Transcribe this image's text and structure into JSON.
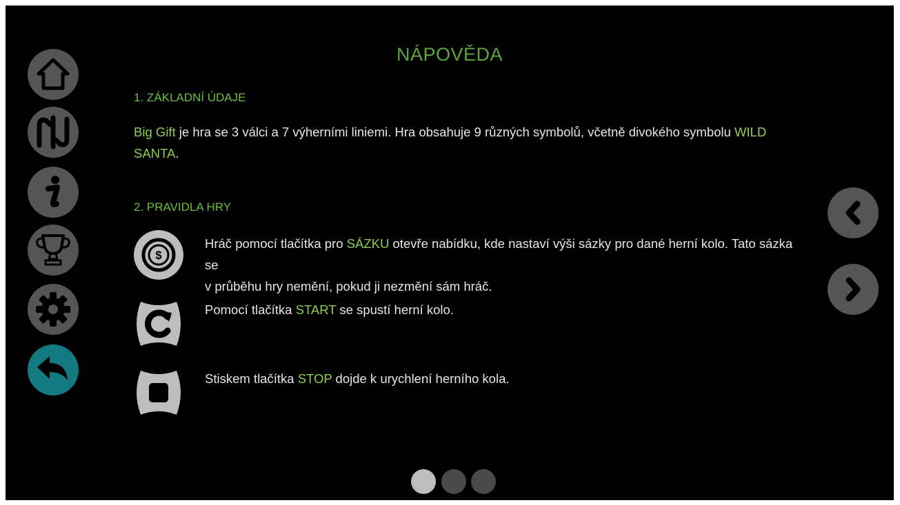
{
  "page": {
    "title": "NÁPOVĚDA"
  },
  "sidebar": {
    "items": [
      {
        "name": "home",
        "icon": "home-icon"
      },
      {
        "name": "paylines",
        "icon": "paylines-icon"
      },
      {
        "name": "info",
        "icon": "info-icon"
      },
      {
        "name": "trophy",
        "icon": "trophy-icon"
      },
      {
        "name": "settings",
        "icon": "gear-icon"
      },
      {
        "name": "back",
        "icon": "back-arrow-icon",
        "active": true
      }
    ],
    "active_color": "#147a82",
    "default_color": "#555555"
  },
  "section1": {
    "heading": "1. ZÁKLADNÍ ÚDAJE",
    "para": {
      "game_name": "Big Gift",
      "text_a": " je hra se 3 válci a 7 výherními liniemi. Hra obsahuje 9 různých symbolů, včetně divokého symbolu ",
      "wild_a": "WILD",
      "wild_b": "SANTA",
      "text_end": "."
    }
  },
  "section2": {
    "heading": "2. PRAVIDLA HRY",
    "rules": [
      {
        "icon": "bet-coin-icon",
        "pre": "Hráč pomocí tlačítka pro ",
        "key": "SÁZKU",
        "post_line1": " otevře nabídku, kde nastaví výši sázky pro dané herní kolo. Tato sázka se",
        "line2": "v průběhu hry nemění, pokud ji nezmění sám hráč."
      },
      {
        "icon": "start-spin-icon",
        "pre": "Pomocí tlačítka ",
        "key": "START",
        "post": " se spustí herní kolo."
      },
      {
        "icon": "stop-icon",
        "pre": "Stiskem tlačítka ",
        "key": "STOP",
        "post": " dojde k urychlení herního kola."
      }
    ]
  },
  "navigation": {
    "prev_icon": "chevron-left-icon",
    "next_icon": "chevron-right-icon"
  },
  "pagination": {
    "pages": 3,
    "current": 1,
    "active_color": "#bdbdbd",
    "inactive_color": "#4a4a4a"
  },
  "colors": {
    "accent_green": "#8fcf50",
    "title_green": "#5aa63a",
    "text": "#e6e6e6",
    "button_grey": "#555555"
  }
}
